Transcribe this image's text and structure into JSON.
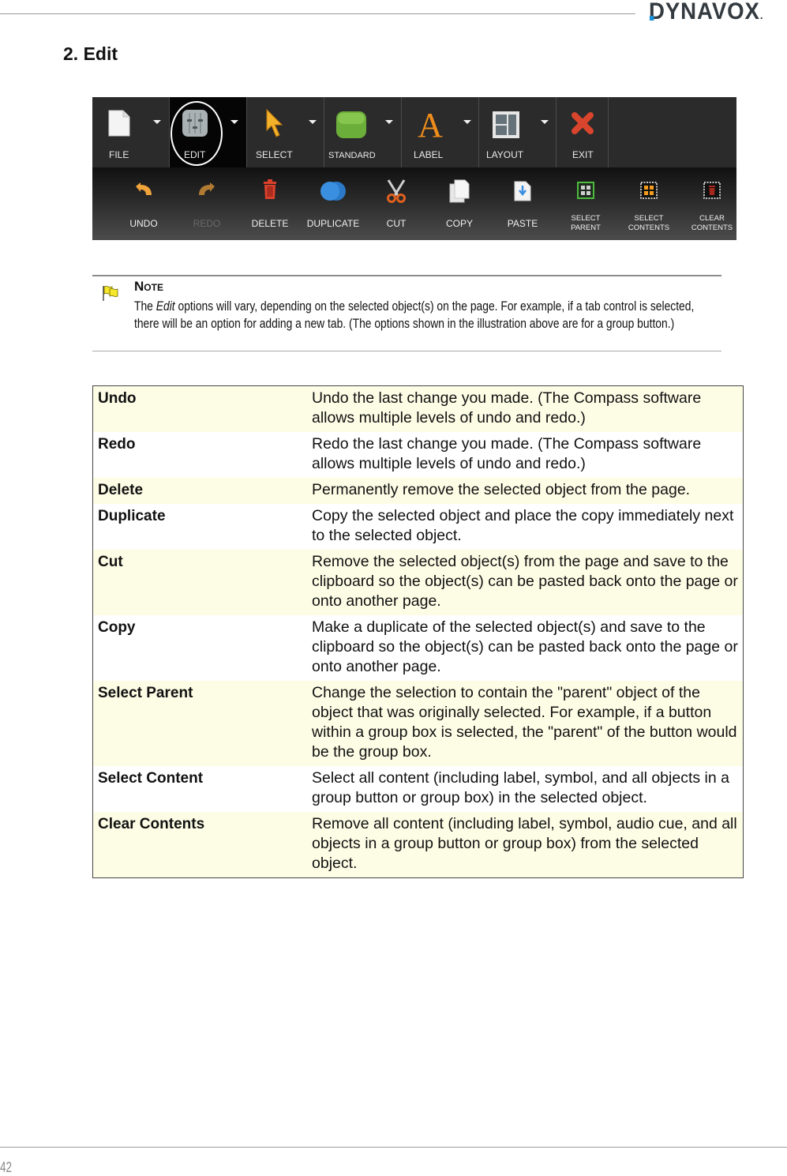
{
  "header": {
    "logo_text": "DYNAVOX",
    "logo_accent": "#1a8fd6"
  },
  "section_title": "2. Edit",
  "toolbar": {
    "top_menus": [
      {
        "id": "file",
        "label": "FILE",
        "icon": "document-icon",
        "has_dropdown": true,
        "active": false
      },
      {
        "id": "edit",
        "label": "EDIT",
        "icon": "sliders-icon",
        "has_dropdown": true,
        "active": true,
        "highlighted": true
      },
      {
        "id": "select",
        "label": "SELECT",
        "icon": "cursor-arrow-icon",
        "has_dropdown": true,
        "active": false
      },
      {
        "id": "standard",
        "label": "STANDARD",
        "icon": "green-button-icon",
        "has_dropdown": true,
        "active": false
      },
      {
        "id": "label",
        "label": "LABEL",
        "icon": "letter-a-icon",
        "has_dropdown": true,
        "active": false
      },
      {
        "id": "layout",
        "label": "LAYOUT",
        "icon": "layout-grid-icon",
        "has_dropdown": true,
        "active": false
      },
      {
        "id": "exit",
        "label": "EXIT",
        "icon": "red-x-icon",
        "has_dropdown": false,
        "active": false
      }
    ],
    "edit_commands": [
      {
        "id": "undo",
        "label": "UNDO",
        "icon": "undo-arrow-icon",
        "enabled": true
      },
      {
        "id": "redo",
        "label": "REDO",
        "icon": "redo-arrow-icon",
        "enabled": false
      },
      {
        "id": "delete",
        "label": "DELETE",
        "icon": "trash-icon",
        "enabled": true
      },
      {
        "id": "duplicate",
        "label": "DUPLICATE",
        "icon": "overlapping-circles-icon",
        "enabled": true
      },
      {
        "id": "cut",
        "label": "CUT",
        "icon": "scissors-icon",
        "enabled": true
      },
      {
        "id": "copy",
        "label": "COPY",
        "icon": "copy-pages-icon",
        "enabled": true
      },
      {
        "id": "paste",
        "label": "PASTE",
        "icon": "paste-page-icon",
        "enabled": true
      },
      {
        "id": "select_parent",
        "label_line1": "SELECT",
        "label_line2": "PARENT",
        "icon": "select-parent-icon",
        "enabled": true
      },
      {
        "id": "select_contents",
        "label_line1": "SELECT",
        "label_line2": "CONTENTS",
        "icon": "select-contents-icon",
        "enabled": true
      },
      {
        "id": "clear_contents",
        "label_line1": "CLEAR",
        "label_line2": "CONTENTS",
        "icon": "clear-contents-icon",
        "enabled": true
      }
    ]
  },
  "note": {
    "title": "Note",
    "body_before": "The ",
    "body_italic": "Edit",
    "body_after": " options will vary, depending on the selected object(s) on the page. For example, if a tab control is selected, there will be an option for adding a new tab. (The options shown in the illustration above are for a group button.)"
  },
  "definitions": [
    {
      "term": "Undo",
      "definition": "Undo the last change you made. (The Compass software allows multiple levels of undo and redo.)",
      "shaded": true
    },
    {
      "term": "Redo",
      "definition": "Redo the last change you made. (The Compass software allows multiple levels of undo and redo.)",
      "shaded": false
    },
    {
      "term": "Delete",
      "definition": "Permanently remove the selected object from the page.",
      "shaded": true
    },
    {
      "term": "Duplicate",
      "definition": "Copy the selected object and place the copy immediately next to the selected object.",
      "shaded": false
    },
    {
      "term": "Cut",
      "definition": "Remove the selected object(s) from the page and save to the clipboard so the object(s) can be pasted back onto the page or onto another page.",
      "shaded": true
    },
    {
      "term": "Copy",
      "definition": "Make a duplicate of the selected object(s) and save to the clipboard so the object(s) can be pasted back onto the page or onto another page.",
      "shaded": false
    },
    {
      "term": "Select Parent",
      "definition": "Change the selection to contain the \"parent\" object of the object that was originally selected. For example, if a button within a group box is selected, the \"parent\" of the button would be the group box.",
      "shaded": true
    },
    {
      "term": "Select Content",
      "definition": "Select all content (including label, symbol, and all objects in a group button or group box) in the selected object.",
      "shaded": false
    },
    {
      "term": "Clear Contents",
      "definition": "Remove all content (including label, symbol, audio cue, and all objects in a group button or group box) from the selected object.",
      "shaded": true
    }
  ],
  "footer": {
    "page_number": "42"
  }
}
